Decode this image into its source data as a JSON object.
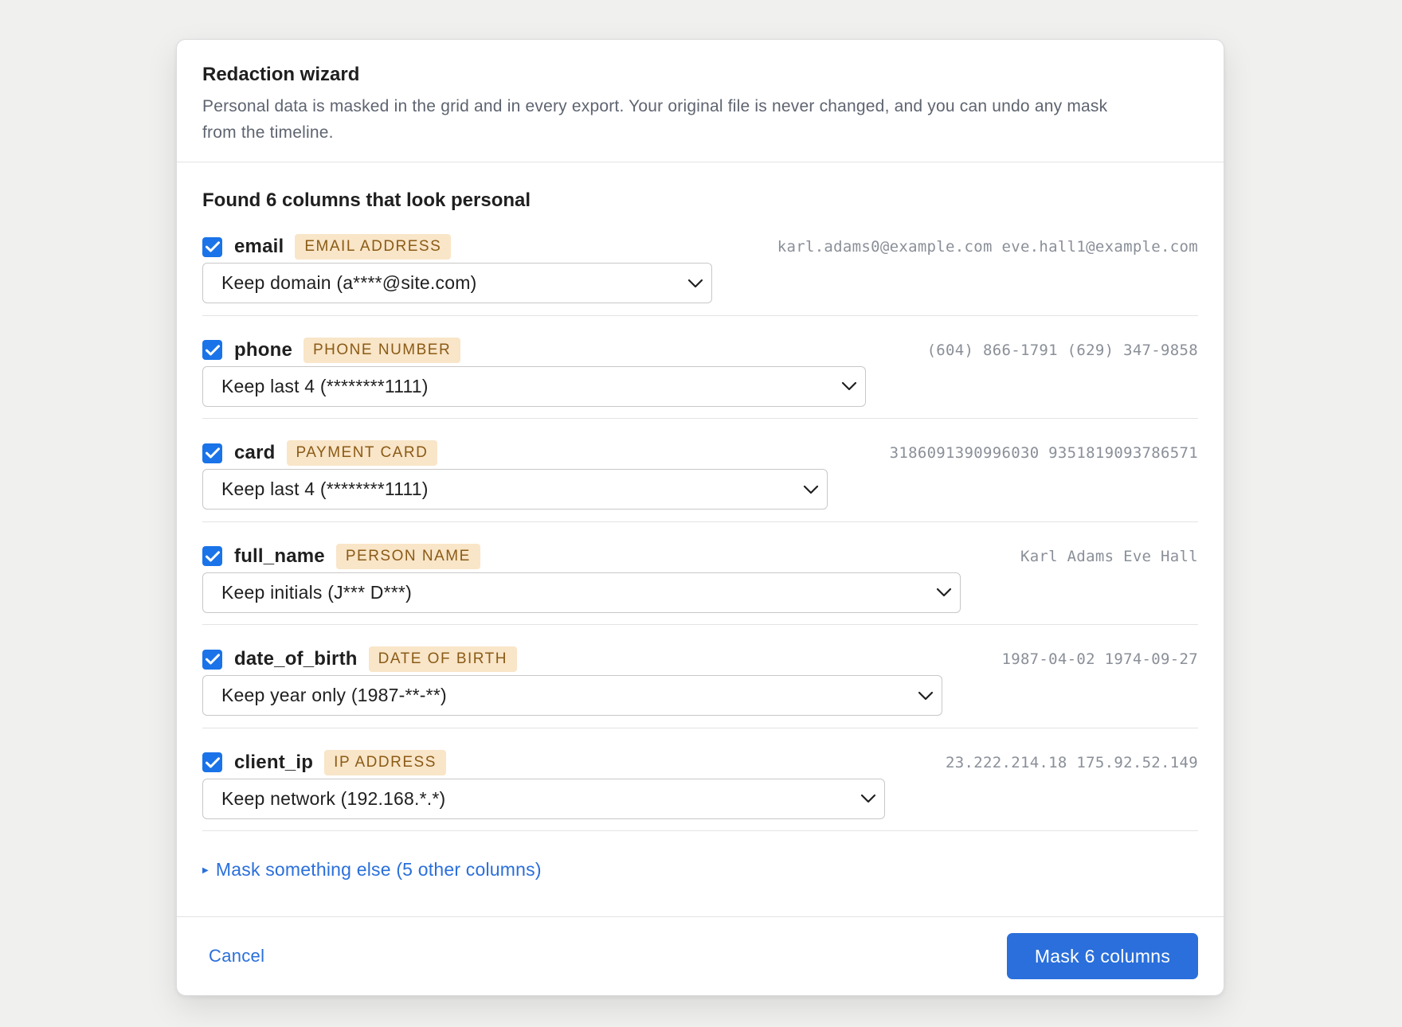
{
  "dialog": {
    "title": "Redaction wizard",
    "subtitle_line1": "Personal data is masked in the grid and in every export. Your original file is never changed, and you can undo any mask",
    "subtitle_line2": "from the timeline."
  },
  "section": {
    "title": "Found 6 columns that look personal"
  },
  "columns": [
    {
      "checked": true,
      "name": "email",
      "type_label": "EMAIL ADDRESS",
      "samples": "karl.adams0@example.com eve.hall1@example.com",
      "mask_option": "Keep domain (a****@site.com)"
    },
    {
      "checked": true,
      "name": "phone",
      "type_label": "PHONE NUMBER",
      "samples": "(604) 866-1791 (629) 347-9858",
      "mask_option": "Keep last 4 (********1111)"
    },
    {
      "checked": true,
      "name": "card",
      "type_label": "PAYMENT CARD",
      "samples": "3186091390996030 9351819093786571",
      "mask_option": "Keep last 4 (********1111)"
    },
    {
      "checked": true,
      "name": "full_name",
      "type_label": "PERSON NAME",
      "samples": "Karl Adams Eve Hall",
      "mask_option": "Keep initials (J*** D***)"
    },
    {
      "checked": true,
      "name": "date_of_birth",
      "type_label": "DATE OF BIRTH",
      "samples": "1987-04-02 1974-09-27",
      "mask_option": "Keep year only (1987-**-**)"
    },
    {
      "checked": true,
      "name": "client_ip",
      "type_label": "IP ADDRESS",
      "samples": "23.222.214.18 175.92.52.149",
      "mask_option": "Keep network (192.168.*.*)"
    }
  ],
  "mask_else": {
    "label": "Mask something else (5 other columns)"
  },
  "footer": {
    "cancel_label": "Cancel",
    "primary_label": "Mask 6 columns"
  },
  "colors": {
    "accent": "#2a6fdb",
    "checkbox": "#1a73e8",
    "pill_bg": "#f9e5c8",
    "pill_text": "#8a5b16"
  }
}
